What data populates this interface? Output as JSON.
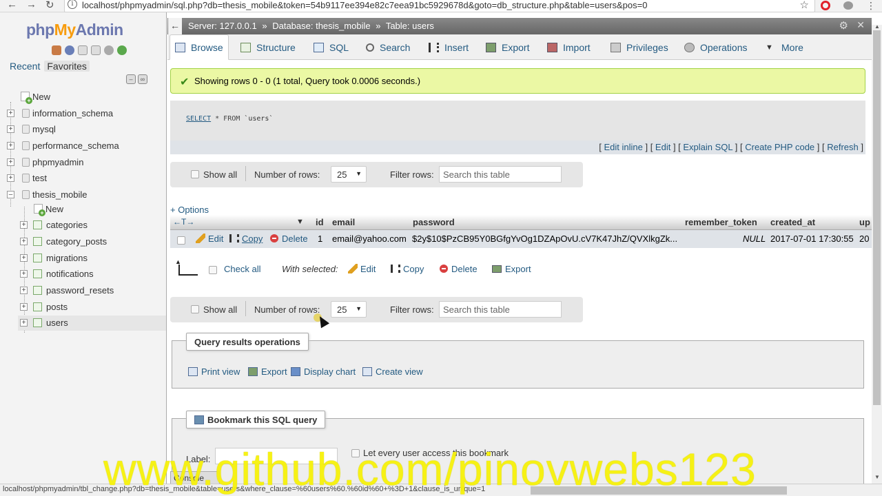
{
  "browser": {
    "url": "localhost/phpmyadmin/sql.php?db=thesis_mobile&token=54b9117ee394e82c7eea91bc5929678d&goto=db_structure.php&table=users&pos=0",
    "info_icon": "i"
  },
  "sidebar": {
    "logo_php": "php",
    "logo_my": "My",
    "logo_admin": "Admin",
    "tab_recent": "Recent",
    "tab_favorites": "Favorites",
    "tree": {
      "new_root": "New",
      "information_schema": "information_schema",
      "mysql": "mysql",
      "performance_schema": "performance_schema",
      "phpmyadmin": "phpmyadmin",
      "test": "test",
      "thesis_mobile": "thesis_mobile",
      "new_table": "New",
      "categories": "categories",
      "category_posts": "category_posts",
      "migrations": "migrations",
      "notifications": "notifications",
      "password_resets": "password_resets",
      "posts": "posts",
      "users": "users"
    }
  },
  "serverbar": {
    "server": "Server: 127.0.0.1",
    "database": "Database: thesis_mobile",
    "table": "Table: users",
    "sep": "»"
  },
  "tabs": {
    "browse": "Browse",
    "structure": "Structure",
    "sql": "SQL",
    "search": "Search",
    "insert": "Insert",
    "export": "Export",
    "import": "Import",
    "privileges": "Privileges",
    "operations": "Operations",
    "more": "More"
  },
  "message": {
    "success": "Showing rows 0 - 0 (1 total, Query took 0.0006 seconds.)"
  },
  "query": {
    "kw": "SELECT",
    "rest": " * FROM ",
    "table": "`users`",
    "link_edit_inline": "Edit inline",
    "link_edit": "Edit",
    "link_explain": "Explain SQL",
    "link_create_php": "Create PHP code",
    "link_refresh": "Refresh"
  },
  "navbar": {
    "show_all": "Show all",
    "number_of_rows": "Number of rows:",
    "rows_value": "25",
    "filter_rows": "Filter rows:",
    "filter_placeholder": "Search this table"
  },
  "options_link": "+ Options",
  "table": {
    "headers": {
      "arrows": "←T→",
      "sort": "▼",
      "id": "id",
      "email": "email",
      "password": "password",
      "remember_token": "remember_token",
      "created_at": "created_at",
      "updated_at": "up"
    },
    "row": {
      "edit": "Edit",
      "copy": "Copy",
      "delete": "Delete",
      "id": "1",
      "email": "email@yahoo.com",
      "password": "$2y$10$PzCB95Y0BGfgYvOg1DZApOvU.cV7K47JhZ/QVXlkgZk...",
      "remember_token": "NULL",
      "created_at": "2017-07-01 17:30:55",
      "updated_at": "20"
    }
  },
  "with_selected": {
    "check_all": "Check all",
    "label": "With selected:",
    "edit": "Edit",
    "copy": "Copy",
    "delete": "Delete",
    "export": "Export"
  },
  "query_results": {
    "legend": "Query results operations",
    "print_view": "Print view",
    "export": "Export",
    "display_chart": "Display chart",
    "create_view": "Create view"
  },
  "bookmark": {
    "legend": "Bookmark this SQL query",
    "label": "Label:",
    "let_every_user": "Let every user access this bookmark"
  },
  "console": "Console",
  "statusbar": "localhost/phpmyadmin/tbl_change.php?db=thesis_mobile&table=users&where_clause=%60users%60.%60id%60+%3D+1&clause_is_unique=1",
  "watermark": "www.github.com/pinovwebs123",
  "colors": {
    "link": "#235a81",
    "success_bg": "#ebf8a4",
    "watermark": "#f7f20a"
  }
}
